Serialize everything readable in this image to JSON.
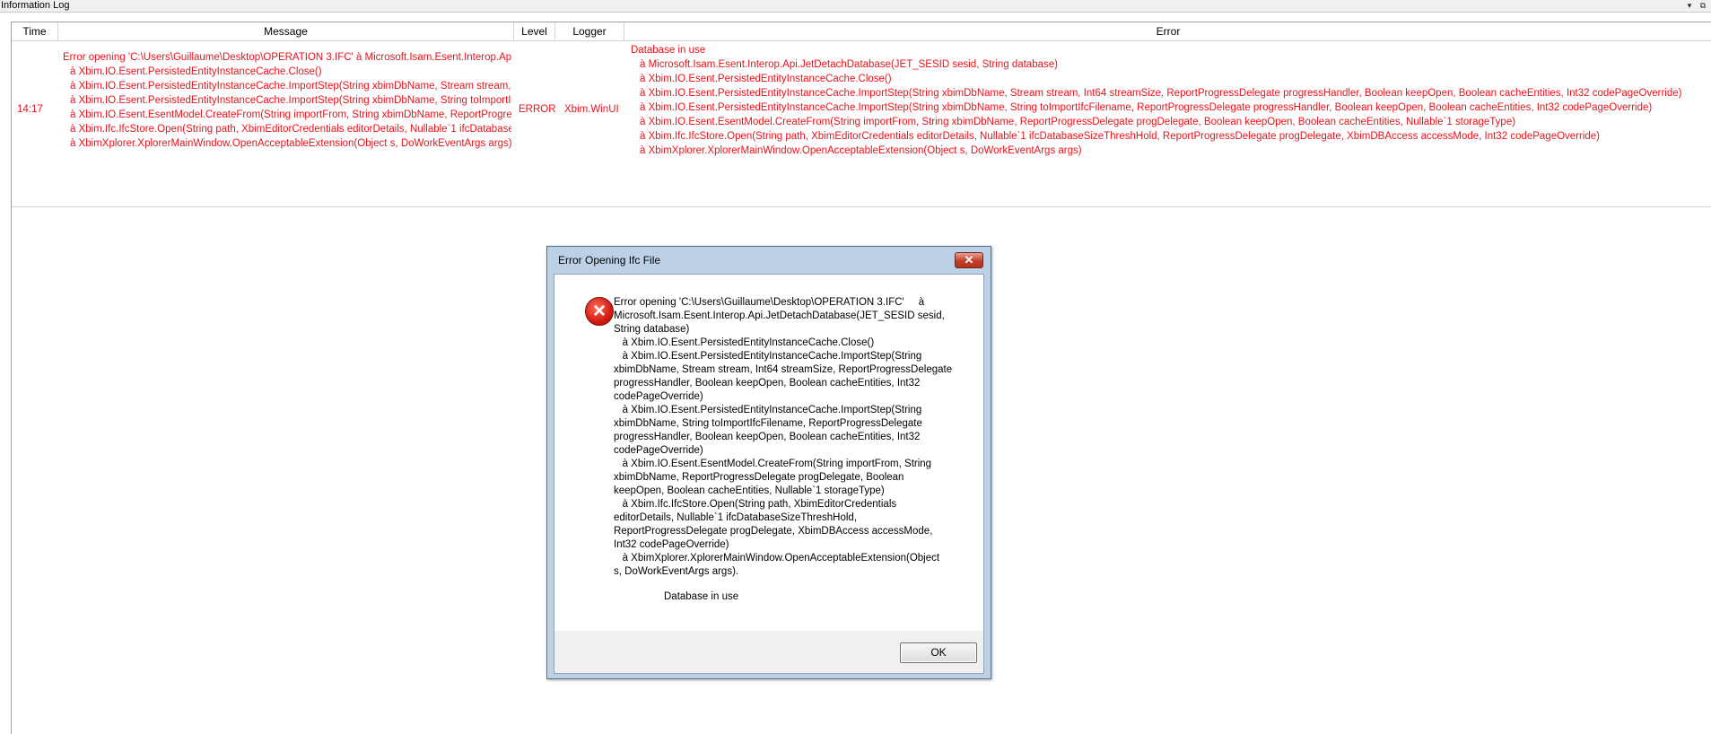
{
  "panel": {
    "title": "Information Log",
    "dropdown_icon": "▾",
    "dock_icon": "⧉"
  },
  "grid": {
    "columns": {
      "time": "Time",
      "message": "Message",
      "level": "Level",
      "logger": "Logger",
      "error": "Error"
    },
    "row": {
      "time": "14:17",
      "message_lines": [
        "Error opening 'C:\\Users\\Guillaume\\Desktop\\OPERATION 3.IFC'     à Microsoft.Isam.Esent.Interop.Api.JetDetachDatabase(JET_SESID sesid, String database)",
        "à Xbim.IO.Esent.PersistedEntityInstanceCache.Close()",
        "à Xbim.IO.Esent.PersistedEntityInstanceCache.ImportStep(String xbimDbName, Stream stream, Int64 streamSize, ReportProgressDelegate progressHandler, Boolean keepOpen, Boolean cacheEntities, Int32 codePageOverride)",
        "à Xbim.IO.Esent.PersistedEntityInstanceCache.ImportStep(String xbimDbName, String toImportIfcFilename, ReportProgressDelegate progressHandler, Boolean keepOpen, Boolean cacheEntities, Int32 codePageOverride)",
        "à Xbim.IO.Esent.EsentModel.CreateFrom(String importFrom, String xbimDbName, ReportProgressDelegate progDelegate, Boolean keepOpen, Boolean cacheEntities, Nullable`1 storageType)",
        "à Xbim.Ifc.IfcStore.Open(String path, XbimEditorCredentials editorDetails, Nullable`1 ifcDatabaseSizeThreshHold, ReportProgressDelegate progDelegate, XbimDBAccess accessMode, Int32 codePageOverride)",
        "à XbimXplorer.XplorerMainWindow.OpenAcceptableExtension(Object s, DoWorkEventArgs args)"
      ],
      "level": "ERROR",
      "logger": "Xbim.WinUI",
      "error_lines": [
        "Database in use",
        "à Microsoft.Isam.Esent.Interop.Api.JetDetachDatabase(JET_SESID sesid, String database)",
        "à Xbim.IO.Esent.PersistedEntityInstanceCache.Close()",
        "à Xbim.IO.Esent.PersistedEntityInstanceCache.ImportStep(String xbimDbName, Stream stream, Int64 streamSize, ReportProgressDelegate progressHandler, Boolean keepOpen, Boolean cacheEntities, Int32 codePageOverride)",
        "à Xbim.IO.Esent.PersistedEntityInstanceCache.ImportStep(String xbimDbName, String toImportIfcFilename, ReportProgressDelegate progressHandler, Boolean keepOpen, Boolean cacheEntities, Int32 codePageOverride)",
        "à Xbim.IO.Esent.EsentModel.CreateFrom(String importFrom, String xbimDbName, ReportProgressDelegate progDelegate, Boolean keepOpen, Boolean cacheEntities, Nullable`1 storageType)",
        "à Xbim.Ifc.IfcStore.Open(String path, XbimEditorCredentials editorDetails, Nullable`1 ifcDatabaseSizeThreshHold, ReportProgressDelegate progDelegate, XbimDBAccess accessMode, Int32 codePageOverride)",
        "à XbimXplorer.XplorerMainWindow.OpenAcceptableExtension(Object s, DoWorkEventArgs args)"
      ]
    }
  },
  "dialog": {
    "title": "Error Opening Ifc File",
    "close_glyph": "✕",
    "icon": "error-icon",
    "message": "Error opening 'C:\\Users\\Guillaume\\Desktop\\OPERATION 3.IFC'     à\nMicrosoft.Isam.Esent.Interop.Api.JetDetachDatabase(JET_SESID sesid,\nString database)\n   à Xbim.IO.Esent.PersistedEntityInstanceCache.Close()\n   à Xbim.IO.Esent.PersistedEntityInstanceCache.ImportStep(String\nxbimDbName, Stream stream, Int64 streamSize, ReportProgressDelegate\nprogressHandler, Boolean keepOpen, Boolean cacheEntities, Int32\ncodePageOverride)\n   à Xbim.IO.Esent.PersistedEntityInstanceCache.ImportStep(String\nxbimDbName, String toImportIfcFilename, ReportProgressDelegate\nprogressHandler, Boolean keepOpen, Boolean cacheEntities, Int32\ncodePageOverride)\n   à Xbim.IO.Esent.EsentModel.CreateFrom(String importFrom, String\nxbimDbName, ReportProgressDelegate progDelegate, Boolean\nkeepOpen, Boolean cacheEntities, Nullable`1 storageType)\n   à Xbim.Ifc.IfcStore.Open(String path, XbimEditorCredentials\neditorDetails, Nullable`1 ifcDatabaseSizeThreshHold,\nReportProgressDelegate progDelegate, XbimDBAccess accessMode,\nInt32 codePageOverride)\n   à XbimXplorer.XplorerMainWindow.OpenAcceptableExtension(Object\ns, DoWorkEventArgs args).",
    "sub_message": "Database in use",
    "ok_label": "OK"
  },
  "colors": {
    "error_text": "#e8131b",
    "dialog_frame": "#bcd0e6"
  }
}
